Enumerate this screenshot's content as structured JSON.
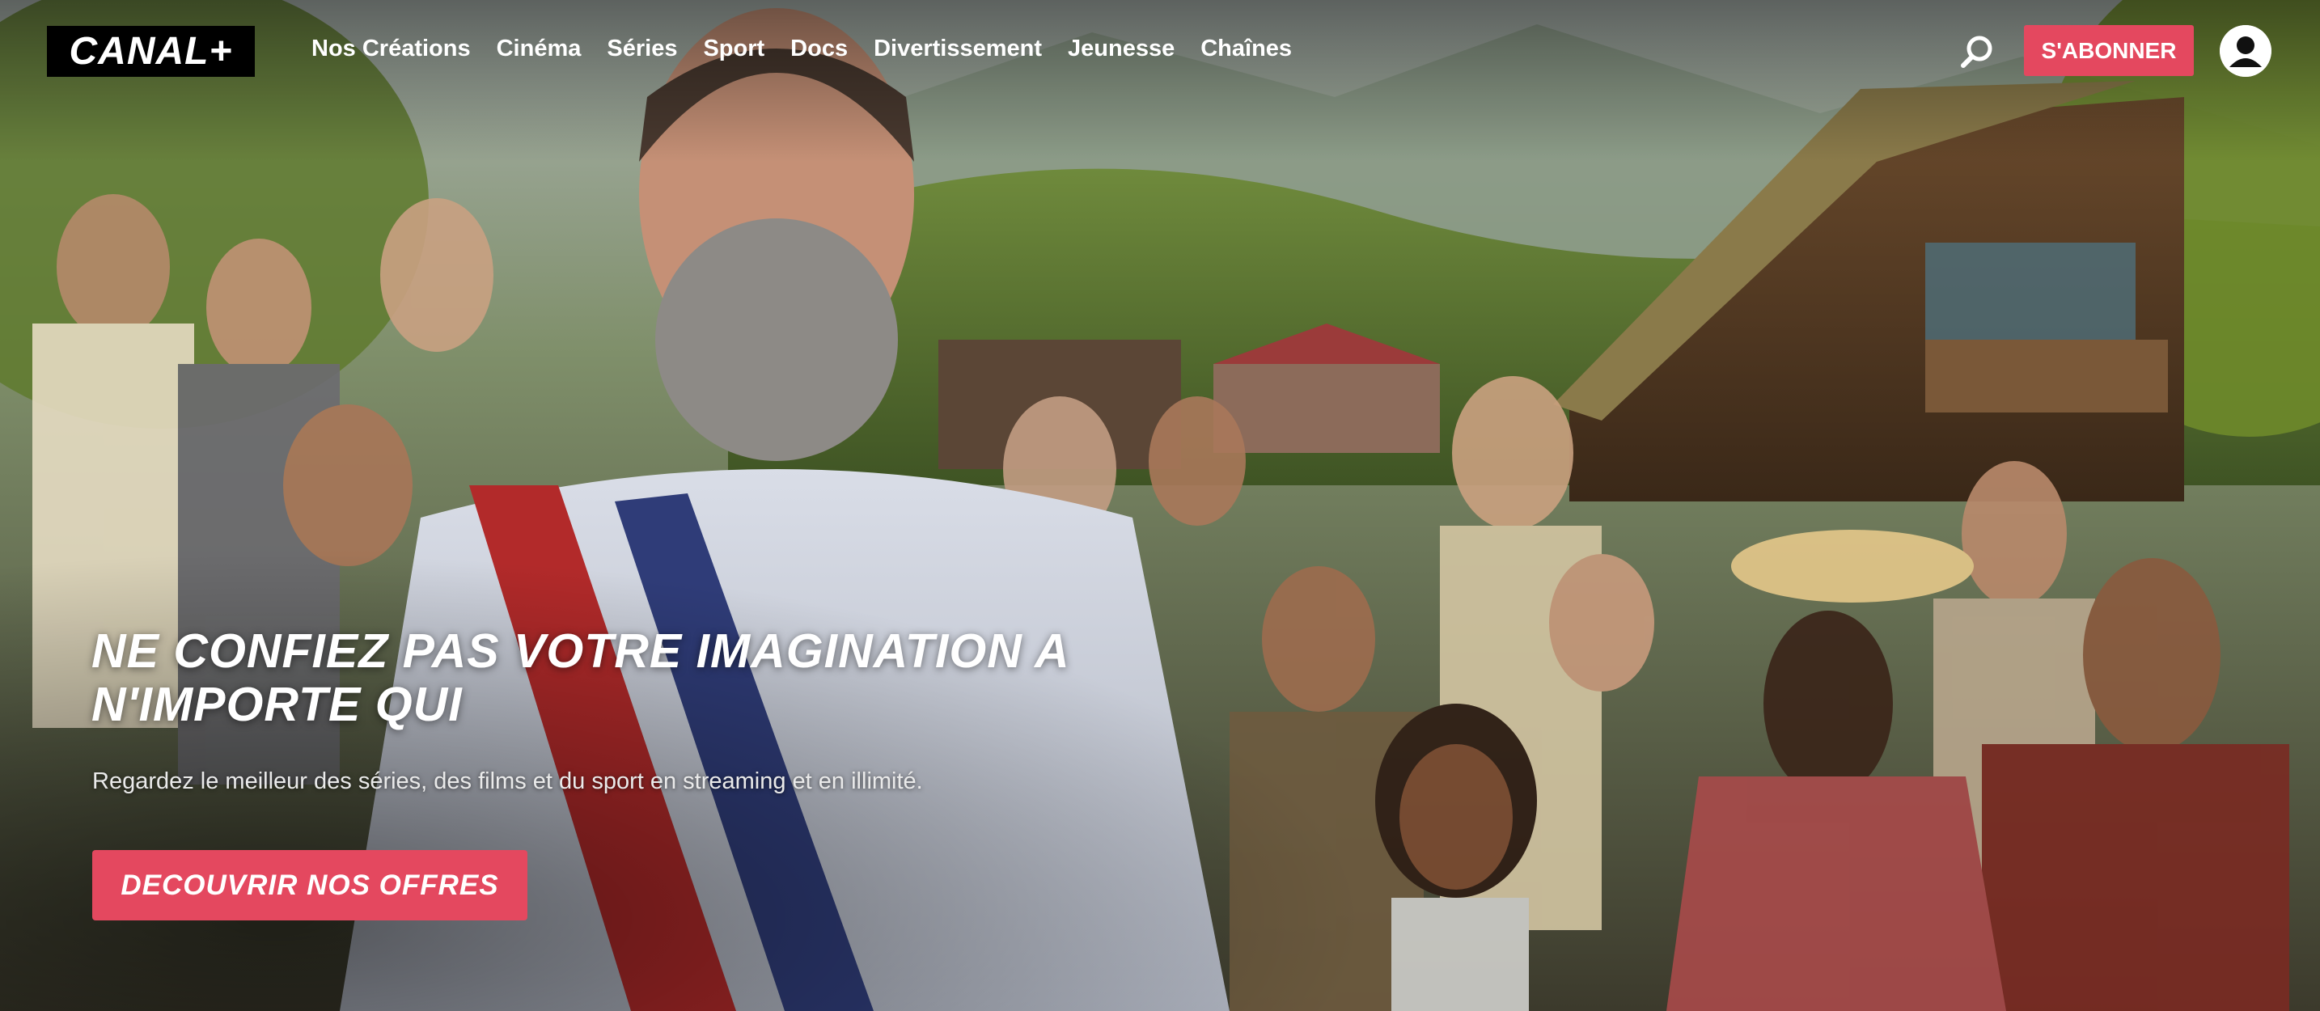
{
  "header": {
    "logo_text": "CANAL+",
    "nav": [
      {
        "label": "Nos Créations"
      },
      {
        "label": "Cinéma"
      },
      {
        "label": "Séries"
      },
      {
        "label": "Sport"
      },
      {
        "label": "Docs"
      },
      {
        "label": "Divertissement"
      },
      {
        "label": "Jeunesse"
      },
      {
        "label": "Chaînes"
      }
    ],
    "search_icon": "search-icon",
    "subscribe_label": "S'ABONNER",
    "account_icon": "user-icon"
  },
  "hero": {
    "headline": "NE CONFIEZ PAS VOTRE IMAGINATION A N'IMPORTE QUI",
    "subtext": "Regardez le meilleur des séries, des films et du sport en streaming et en illimité.",
    "cta_label": "DECOUVRIR NOS OFFRES"
  },
  "colors": {
    "accent": "#e4485f",
    "logo_bg": "#000000",
    "text": "#ffffff"
  }
}
